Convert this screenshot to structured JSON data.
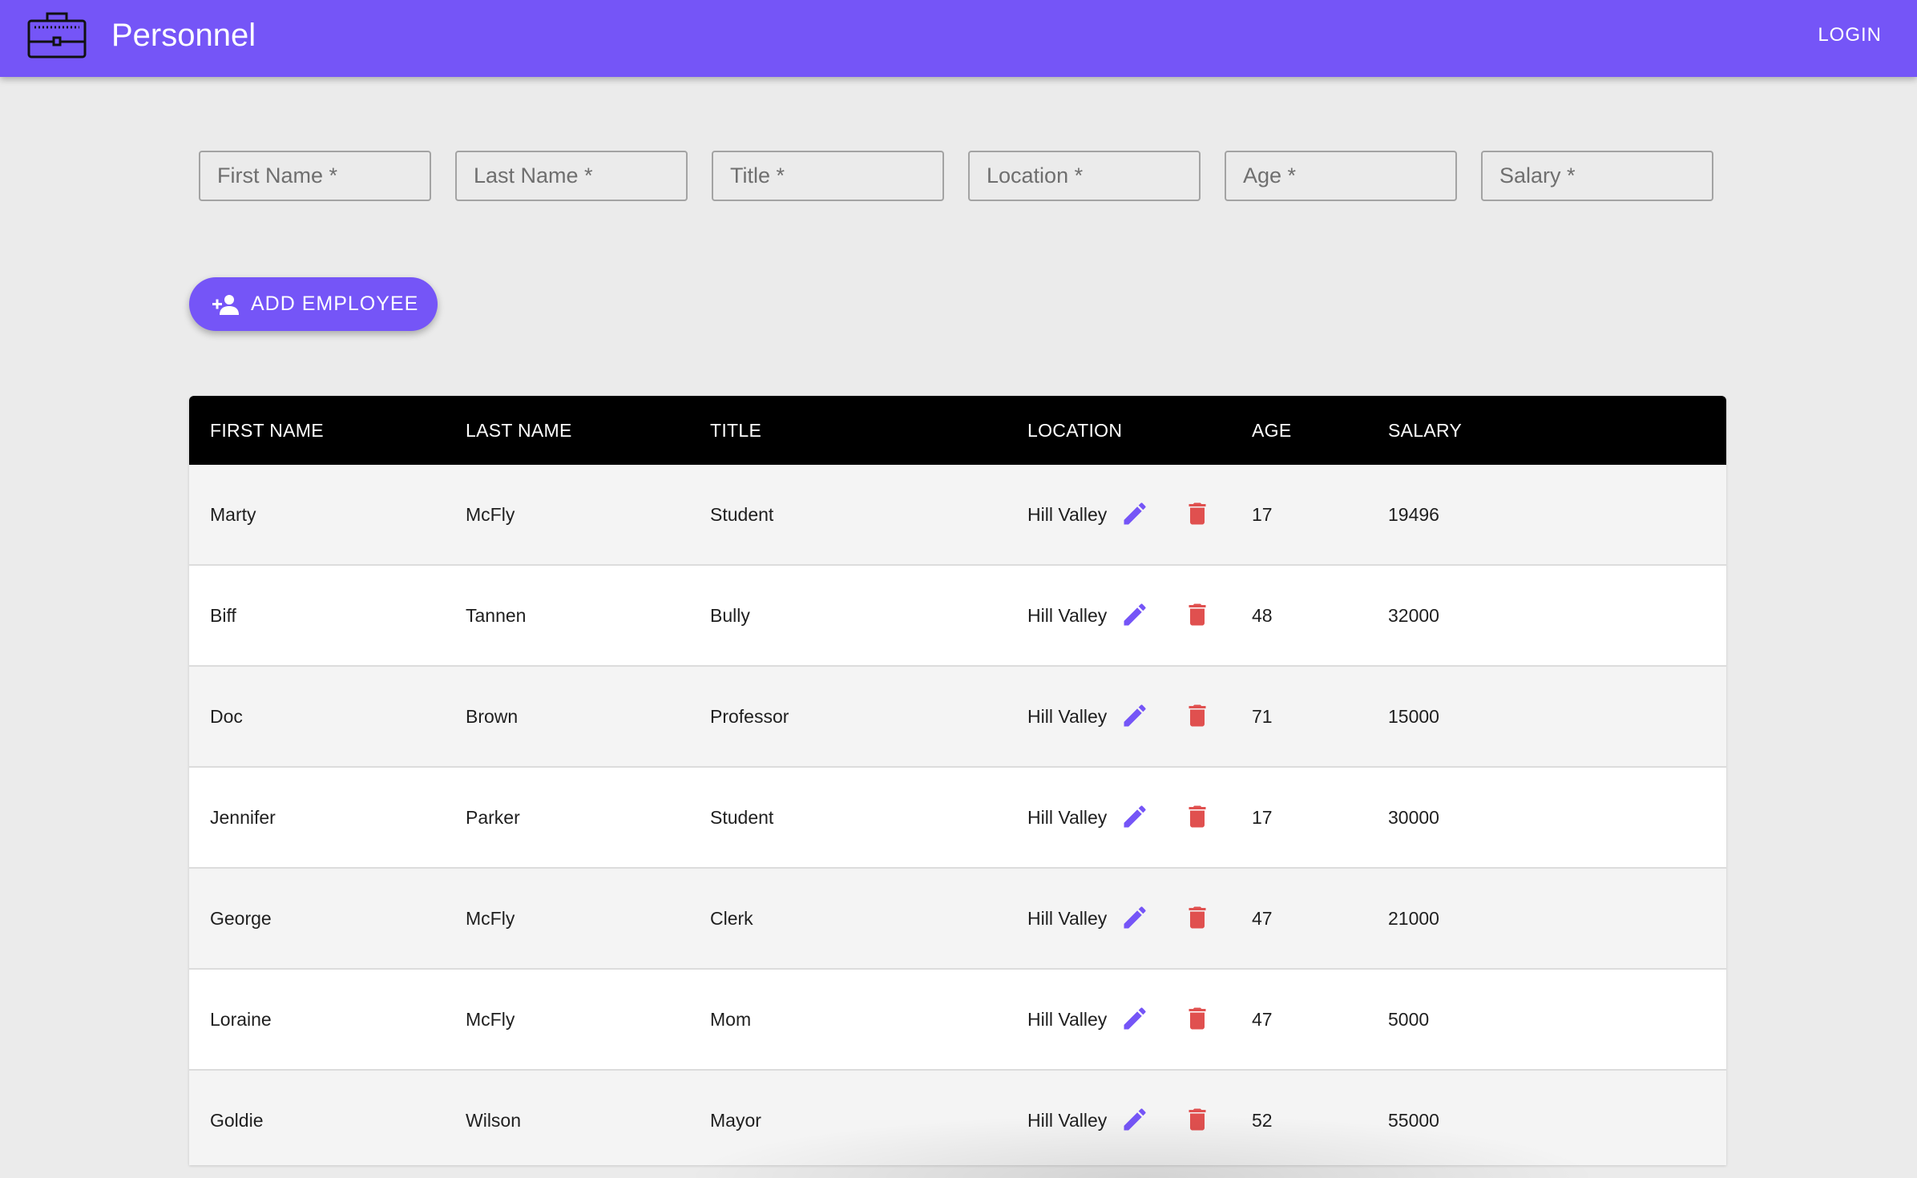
{
  "app": {
    "title": "Personnel",
    "login_label": "LOGIN",
    "brand_icon": "briefcase-icon",
    "accent_color": "#7555f7"
  },
  "form": {
    "fields": [
      {
        "name": "first-name",
        "placeholder": "First Name *"
      },
      {
        "name": "last-name",
        "placeholder": "Last Name *"
      },
      {
        "name": "title",
        "placeholder": "Title *"
      },
      {
        "name": "location",
        "placeholder": "Location *"
      },
      {
        "name": "age",
        "placeholder": "Age *"
      },
      {
        "name": "salary",
        "placeholder": "Salary *"
      }
    ],
    "add_button_label": "ADD EMPLOYEE",
    "add_button_icon": "person-add-icon"
  },
  "table": {
    "columns": [
      "FIRST NAME",
      "LAST NAME",
      "TITLE",
      "LOCATION",
      "AGE",
      "SALARY"
    ],
    "rows": [
      [
        "Marty",
        "McFly",
        "Student",
        "Hill Valley",
        "17",
        "19496"
      ],
      [
        "Biff",
        "Tannen",
        "Bully",
        "Hill Valley",
        "48",
        "32000"
      ],
      [
        "Doc",
        "Brown",
        "Professor",
        "Hill Valley",
        "71",
        "15000"
      ],
      [
        "Jennifer",
        "Parker",
        "Student",
        "Hill Valley",
        "17",
        "30000"
      ],
      [
        "George",
        "McFly",
        "Clerk",
        "Hill Valley",
        "47",
        "21000"
      ],
      [
        "Loraine",
        "McFly",
        "Mom",
        "Hill Valley",
        "47",
        "5000"
      ],
      [
        "Goldie",
        "Wilson",
        "Mayor",
        "Hill Valley",
        "52",
        "55000"
      ]
    ],
    "edit_icon": "pencil-icon",
    "delete_icon": "trash-icon",
    "edit_color": "#7555f7",
    "delete_color": "#e0504f"
  }
}
